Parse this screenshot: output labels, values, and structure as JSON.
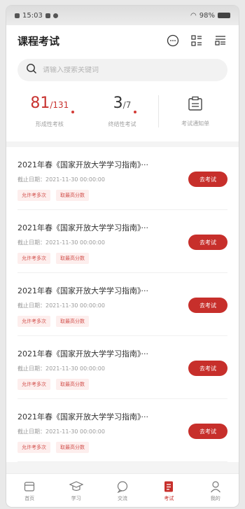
{
  "status_bar": {
    "time": "15:03",
    "battery": "98%"
  },
  "header": {
    "title": "课程考试"
  },
  "search": {
    "placeholder": "请输入搜索关键词"
  },
  "stats": [
    {
      "value": "81",
      "total": "/131",
      "label": "形成性考核",
      "color": "red"
    },
    {
      "value": "3",
      "total": "/7",
      "label": "终结性考试",
      "color": "dark"
    }
  ],
  "notice": {
    "label": "考试通知单"
  },
  "exams": [
    {
      "title": "2021年春《国家开放大学学习指南》···",
      "deadline": "截止日期：2021-11-30 00:00:00",
      "tags": [
        "允许考多次",
        "取最高分数"
      ],
      "button": "去考试"
    },
    {
      "title": "2021年春《国家开放大学学习指南》···",
      "deadline": "截止日期：2021-11-30 00:00:00",
      "tags": [
        "允许考多次",
        "取最高分数"
      ],
      "button": "去考试"
    },
    {
      "title": "2021年春《国家开放大学学习指南》···",
      "deadline": "截止日期：2021-11-30 00:00:00",
      "tags": [
        "允许考多次",
        "取最高分数"
      ],
      "button": "去考试"
    },
    {
      "title": "2021年春《国家开放大学学习指南》···",
      "deadline": "截止日期：2021-11-30 00:00:00",
      "tags": [
        "允许考多次",
        "取最高分数"
      ],
      "button": "去考试"
    },
    {
      "title": "2021年春《国家开放大学学习指南》···",
      "deadline": "截止日期：2021-11-30 00:00:00",
      "tags": [
        "允许考多次",
        "取最高分数"
      ],
      "button": "去考试"
    }
  ],
  "nav": [
    {
      "label": "首页",
      "icon": "home-icon"
    },
    {
      "label": "学习",
      "icon": "graduation-cap-icon"
    },
    {
      "label": "交流",
      "icon": "chat-icon"
    },
    {
      "label": "考试",
      "icon": "exam-icon",
      "active": true
    },
    {
      "label": "我的",
      "icon": "profile-icon"
    }
  ],
  "colors": {
    "accent": "#c72f2b",
    "tag_bg": "#fdeeed"
  }
}
